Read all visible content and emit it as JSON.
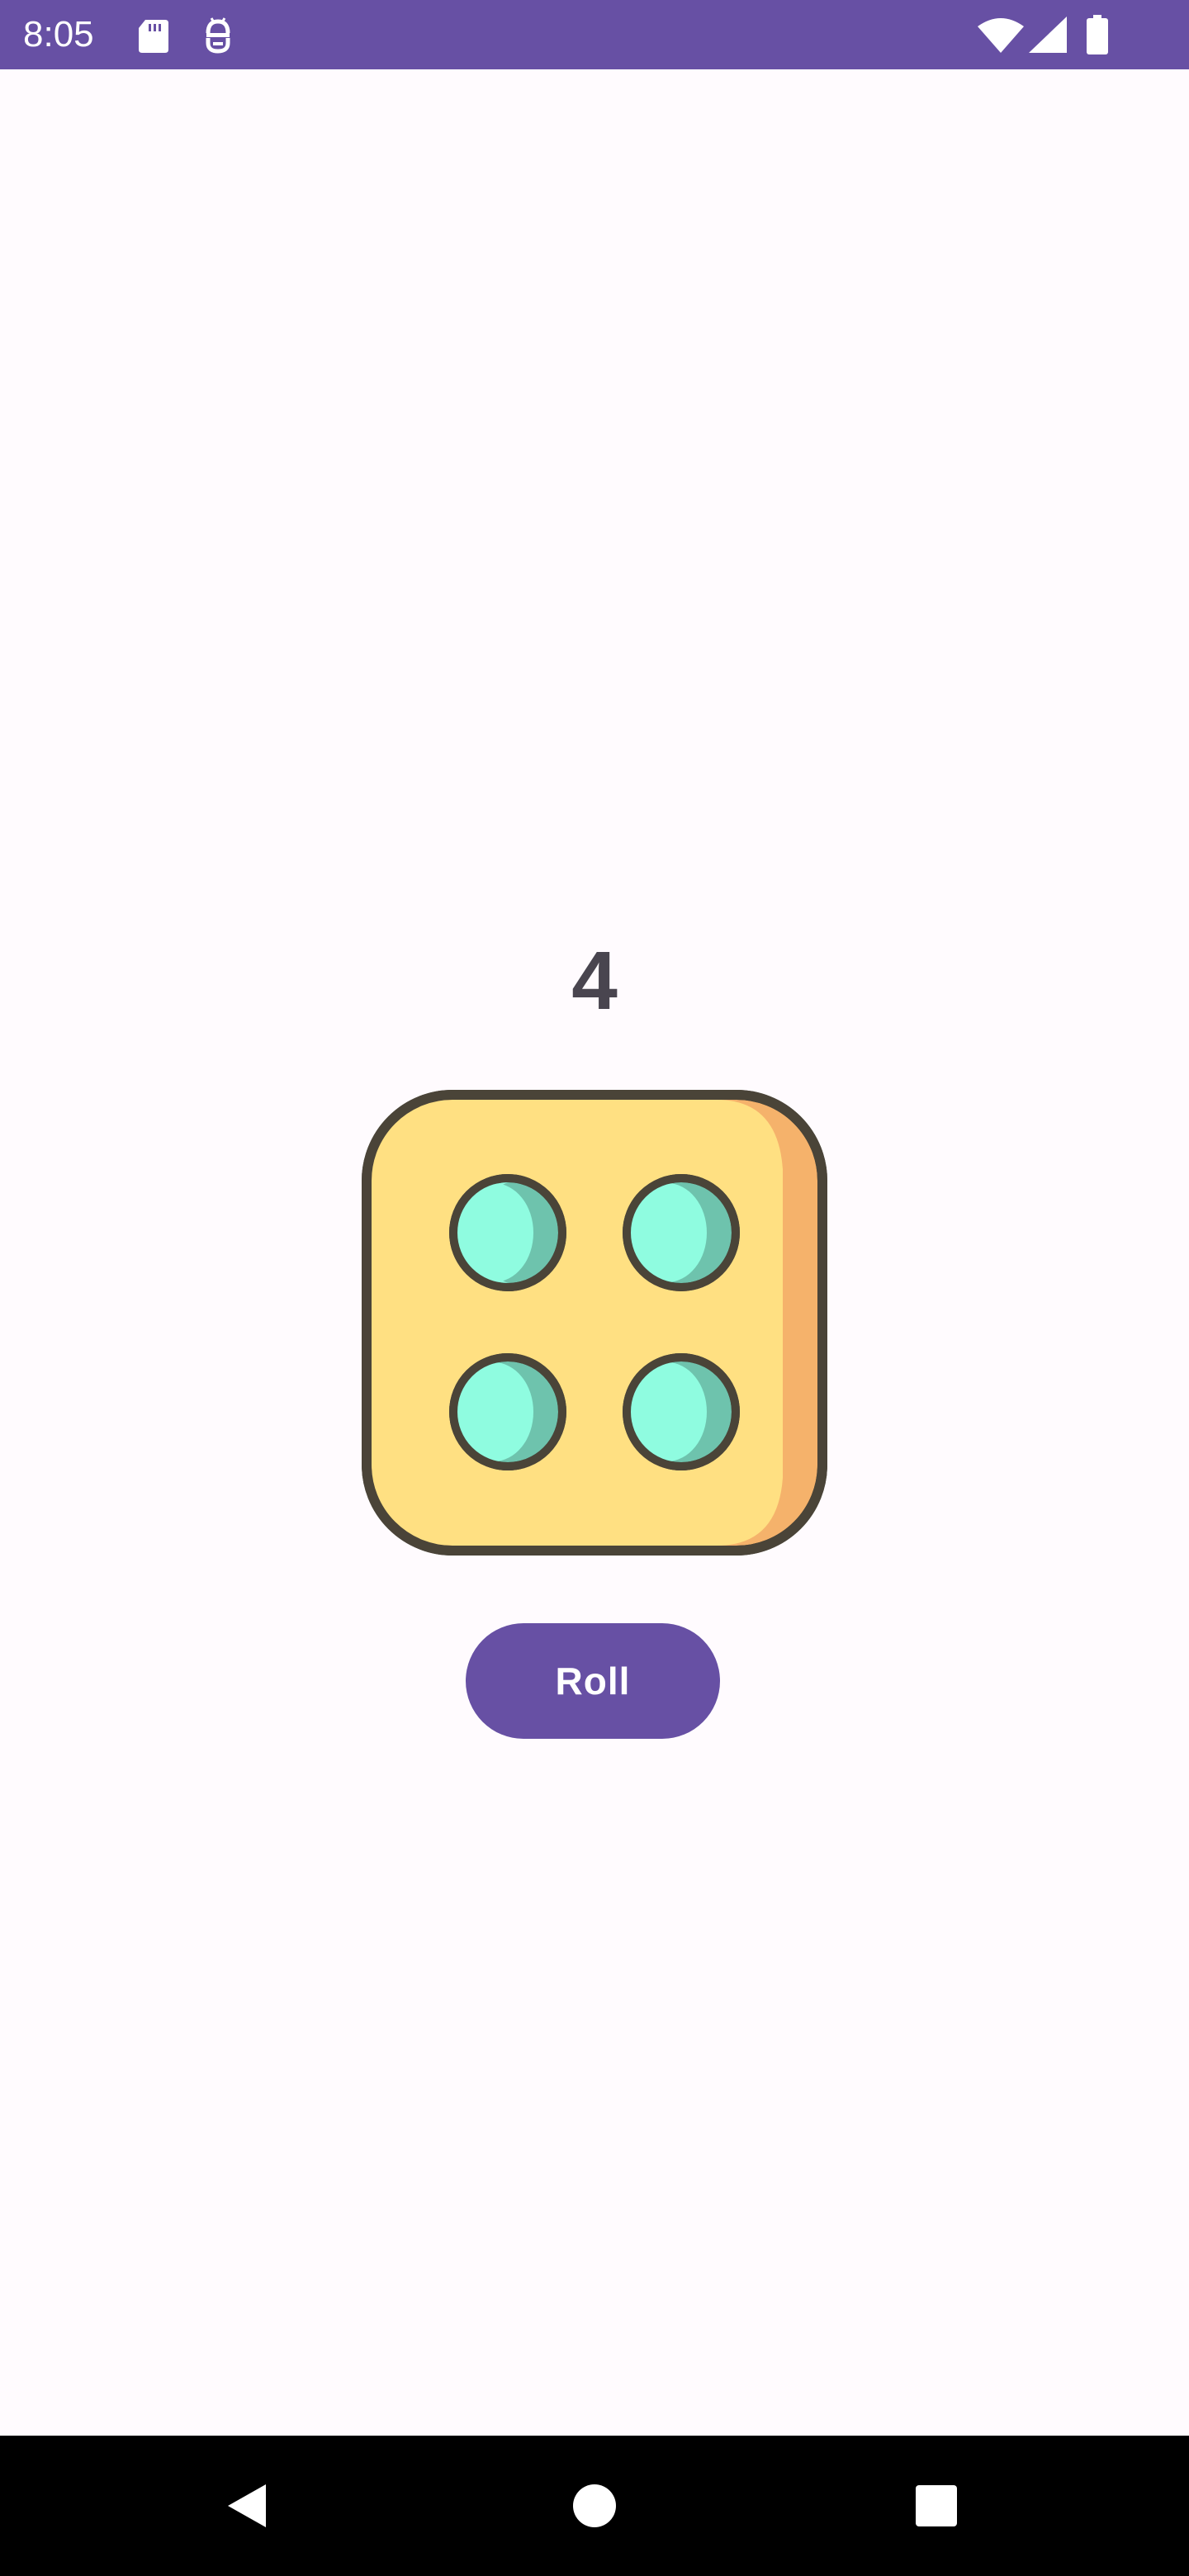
{
  "status_bar": {
    "time": "8:05",
    "icons": [
      "sd-card-icon",
      "android-debug-icon",
      "wifi-icon",
      "cellular-signal-icon",
      "battery-icon"
    ],
    "background_color": "#6750a4"
  },
  "app": {
    "result_value": "4",
    "dice_face": 4,
    "roll_button_label": "Roll",
    "accent_color": "#6750a4",
    "dice_colors": {
      "face": "#ffe082",
      "side_shade": "#f5b26b",
      "outline": "#4a4438",
      "pip": "#8ffce0",
      "pip_shade": "#6ec3ad"
    }
  },
  "nav_bar": {
    "buttons": [
      "back-icon",
      "home-icon",
      "recents-icon"
    ]
  }
}
